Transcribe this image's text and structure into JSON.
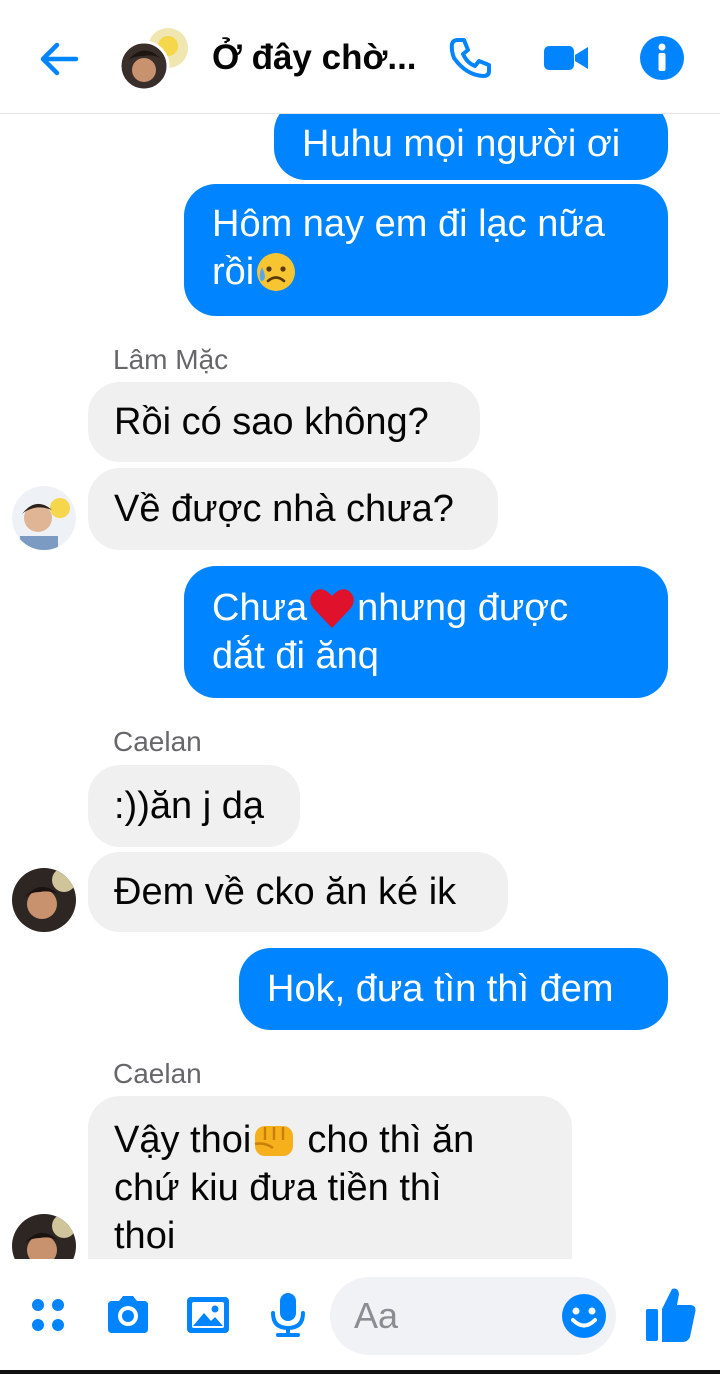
{
  "header": {
    "title": "Ở đây chờ...",
    "icons": [
      "back-arrow-icon",
      "phone-icon",
      "video-camera-icon",
      "info-icon"
    ]
  },
  "messages": [
    {
      "type": "out",
      "lines": [
        "Huhu mọi người ơi"
      ]
    },
    {
      "type": "out",
      "lines": [
        "Hôm nay em đi lạc nữa",
        "rồi"
      ],
      "emoji": "sad-sweat-emoji"
    },
    {
      "type": "sender",
      "name": "Lâm Mặc"
    },
    {
      "type": "in",
      "lines": [
        "Rồi có sao không?"
      ]
    },
    {
      "type": "in",
      "lines": [
        "Về được nhà chưa?"
      ]
    },
    {
      "type": "out",
      "lines": [
        "Chưa",
        "nhưng được",
        "dắt đi ănq"
      ],
      "emoji": "red-heart-emoji"
    },
    {
      "type": "sender",
      "name": "Caelan"
    },
    {
      "type": "in",
      "lines": [
        ":))ăn j dạ"
      ]
    },
    {
      "type": "in",
      "lines": [
        "Đem về cko ăn ké ik"
      ]
    },
    {
      "type": "out",
      "lines": [
        "Hok, đưa tìn thì đem"
      ]
    },
    {
      "type": "sender",
      "name": "Caelan"
    },
    {
      "type": "in",
      "lines": [
        "Vậy thoi",
        "cho thì ăn",
        "chứ kiu đưa tiền thì",
        "thoi"
      ],
      "emoji": "fist-emoji"
    }
  ],
  "composer": {
    "placeholder": "Aa",
    "icons": [
      "menu-dots-icon",
      "camera-icon",
      "gallery-icon",
      "microphone-icon",
      "emoji-icon",
      "thumbs-up-icon"
    ]
  },
  "colors": {
    "accent": "#0084ff",
    "incoming": "#f0f0f0",
    "sender_label": "#65676b"
  }
}
